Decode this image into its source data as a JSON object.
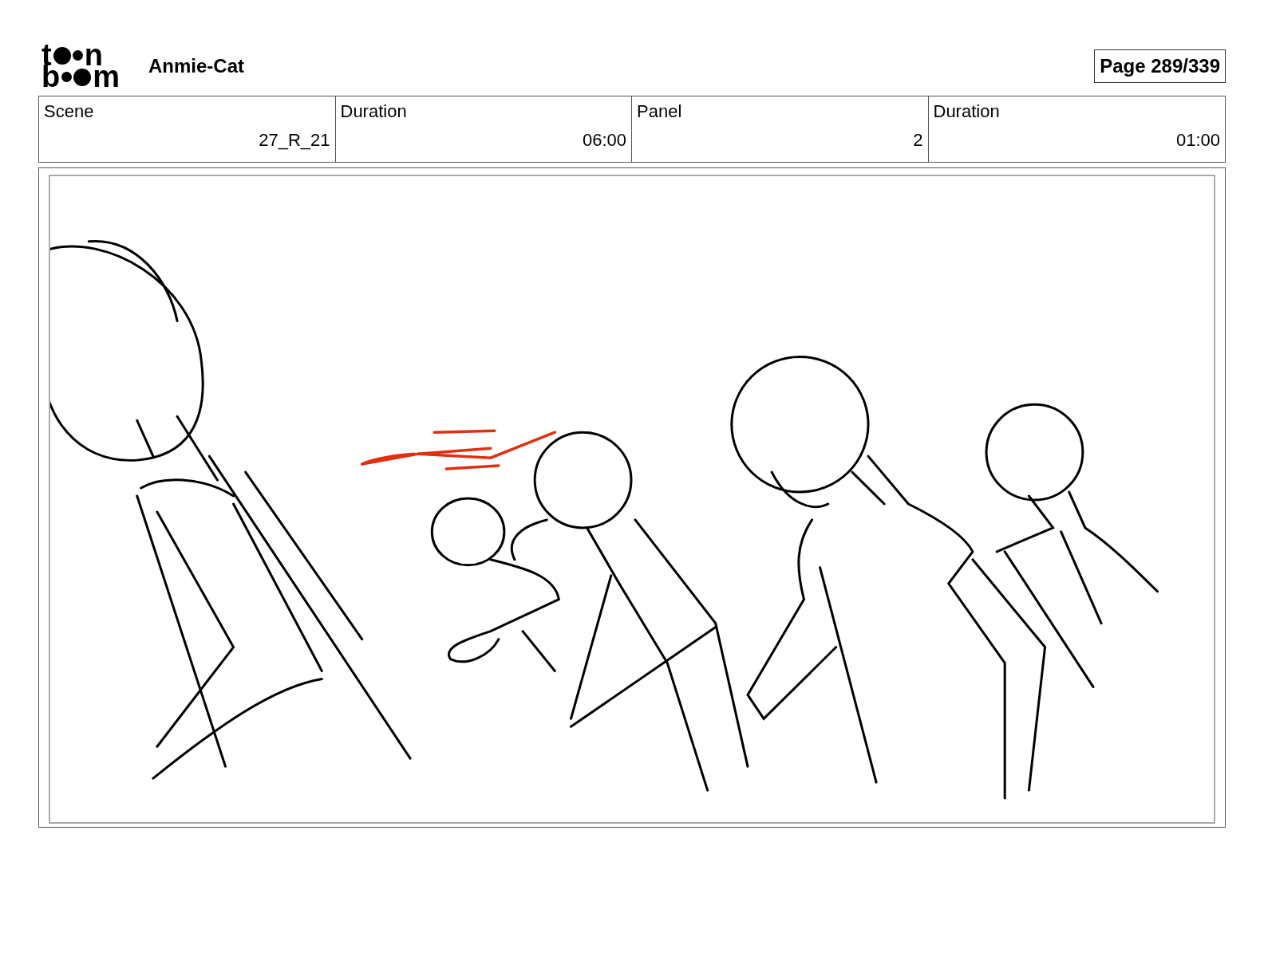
{
  "logo": {
    "rows": [
      {
        "start": "t",
        "end": "n"
      },
      {
        "start": "b",
        "end": "m"
      }
    ]
  },
  "title": "Anmie-Cat",
  "page": "Page 289/339",
  "info_table": {
    "columns": [
      "Scene",
      "Duration",
      "Panel",
      "Duration"
    ],
    "row": [
      "27_R_21",
      "06:00",
      "2",
      "01:00"
    ]
  }
}
